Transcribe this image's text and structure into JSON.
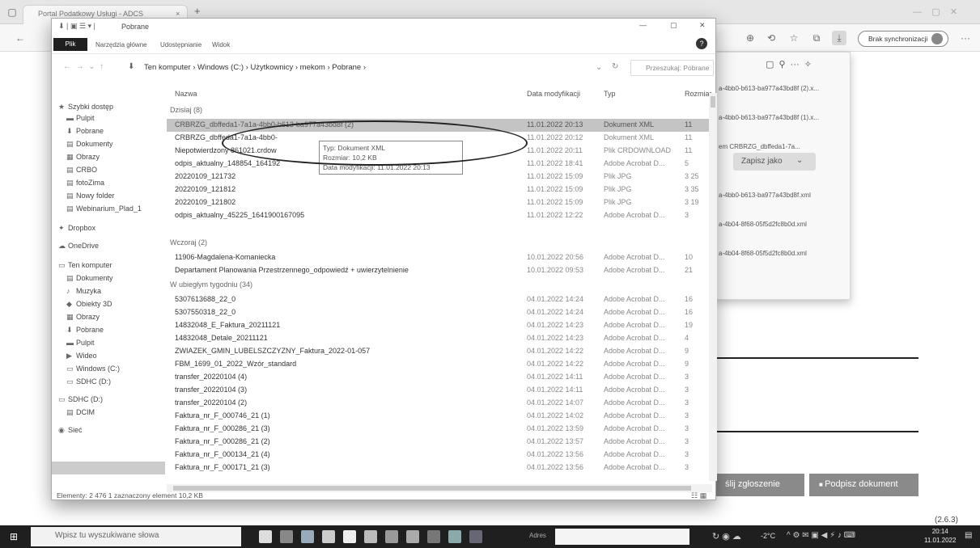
{
  "browser": {
    "tab_title": "Portal Podatkowy Usługi - ADCS",
    "tab_close": "×",
    "new_tab": "+",
    "sync": "Brak synchronizacji",
    "more": "···"
  },
  "downloads": {
    "items": [
      "a-4bb0-b613-ba977a43bd8f (2).x...",
      "a-4bb0-b613-ba977a43bd8f (1).x...",
      "em CRBRZG_dbffeda1-7a...",
      "a-4bb0-b613-ba977a43bd8f.xml",
      "a-4b04-8f68-05f5d2fc8b0d.xml",
      "a-4b04-8f68-05f5d2fc8b0d.xml"
    ],
    "save_as": "Zapisz jako"
  },
  "explorer": {
    "title": "Pobrane",
    "ribbon": {
      "file": "Plik",
      "home": "Narzędzia główne",
      "share": "Udostępnianie",
      "view": "Widok"
    },
    "address": "Ten komputer  ›  Windows (C:)  ›  Użytkownicy  ›  mekom  ›  Pobrane  ›",
    "search": "Przeszukaj: Pobrane",
    "columns": {
      "name": "Nazwa",
      "date": "Data modyfikacji",
      "type": "Typ",
      "size": "Rozmiar"
    },
    "nav": [
      "Szybki dostęp",
      "Pulpit",
      "Pobrane",
      "Dokumenty",
      "Obrazy",
      "CRBO",
      "fotoZima",
      "Nowy folder",
      "Webinarium_Plad_1",
      "Dropbox",
      "OneDrive",
      "Ten komputer",
      "Dokumenty",
      "Muzyka",
      "Obiekty 3D",
      "Obrazy",
      "Pobrane",
      "Pulpit",
      "Wideo",
      "Windows (C:)",
      "SDHC (D:)",
      "SDHC (D:)",
      "DCIM",
      "Sieć"
    ],
    "groups": {
      "today": "Dzisiaj (8)",
      "yesterday": "Wczoraj (2)",
      "last_week": "W ubiegłym tygodniu (34)"
    },
    "rows_today": [
      {
        "n": "CRBRZG_dbffeda1-7a1a-4bb0-b613-ba977a43bd8f (2)",
        "d": "11.01.2022 20:13",
        "t": "Dokument XML",
        "s": "11"
      },
      {
        "n": "CRBRZG_dbffeda1-7a1a-4bb0-",
        "d": "11.01.2022 20:12",
        "t": "Dokument XML",
        "s": "11"
      },
      {
        "n": "Niepotwierdzony 861021.crdow",
        "d": "11.01.2022 20:11",
        "t": "Plik CRDOWNLOAD",
        "s": "11"
      },
      {
        "n": "odpis_aktualny_148854_164192",
        "d": "11.01.2022 18:41",
        "t": "Adobe Acrobat D...",
        "s": "5"
      },
      {
        "n": "20220109_121732",
        "d": "11.01.2022 15:09",
        "t": "Plik JPG",
        "s": "3 25"
      },
      {
        "n": "20220109_121812",
        "d": "11.01.2022 15:09",
        "t": "Plik JPG",
        "s": "3 35"
      },
      {
        "n": "20220109_121802",
        "d": "11.01.2022 15:09",
        "t": "Plik JPG",
        "s": "3 19"
      },
      {
        "n": "odpis_aktualny_45225_1641900167095",
        "d": "11.01.2022 12:22",
        "t": "Adobe Acrobat D...",
        "s": "3"
      }
    ],
    "rows_yesterday": [
      {
        "n": "11906-Magdalena-Komaniecka",
        "d": "10.01.2022 20:56",
        "t": "Adobe Acrobat D...",
        "s": "10"
      },
      {
        "n": "Departament Planowania Przestrzennego_odpowiedź + uwierzytelnienie",
        "d": "10.01.2022 09:53",
        "t": "Adobe Acrobat D...",
        "s": "21"
      }
    ],
    "rows_week": [
      {
        "n": "5307613688_22_0",
        "d": "04.01.2022 14:24",
        "t": "Adobe Acrobat D...",
        "s": "16"
      },
      {
        "n": "5307550318_22_0",
        "d": "04.01.2022 14:24",
        "t": "Adobe Acrobat D...",
        "s": "16"
      },
      {
        "n": "14832048_E_Faktura_20211121",
        "d": "04.01.2022 14:23",
        "t": "Adobe Acrobat D...",
        "s": "19"
      },
      {
        "n": "14832048_Detale_20211121",
        "d": "04.01.2022 14:23",
        "t": "Adobe Acrobat D...",
        "s": "4"
      },
      {
        "n": "ZWIAZEK_GMIN_LUBELSZCZYZNY_Faktura_2022-01-057",
        "d": "04.01.2022 14:22",
        "t": "Adobe Acrobat D...",
        "s": "9"
      },
      {
        "n": "FBM_1699_01_2022_Wzór_standard",
        "d": "04.01.2022 14:22",
        "t": "Adobe Acrobat D...",
        "s": "9"
      },
      {
        "n": "transfer_20220104 (4)",
        "d": "04.01.2022 14:11",
        "t": "Adobe Acrobat D...",
        "s": "3"
      },
      {
        "n": "transfer_20220104 (3)",
        "d": "04.01.2022 14:11",
        "t": "Adobe Acrobat D...",
        "s": "3"
      },
      {
        "n": "transfer_20220104 (2)",
        "d": "04.01.2022 14:07",
        "t": "Adobe Acrobat D...",
        "s": "3"
      },
      {
        "n": "Faktura_nr_F_000746_21 (1)",
        "d": "04.01.2022 14:02",
        "t": "Adobe Acrobat D...",
        "s": "3"
      },
      {
        "n": "Faktura_nr_F_000286_21 (3)",
        "d": "04.01.2022 13:59",
        "t": "Adobe Acrobat D...",
        "s": "3"
      },
      {
        "n": "Faktura_nr_F_000286_21 (2)",
        "d": "04.01.2022 13:57",
        "t": "Adobe Acrobat D...",
        "s": "3"
      },
      {
        "n": "Faktura_nr_F_000134_21 (4)",
        "d": "04.01.2022 13:56",
        "t": "Adobe Acrobat D...",
        "s": "3"
      },
      {
        "n": "Faktura_nr_F_000171_21 (3)",
        "d": "04.01.2022 13:56",
        "t": "Adobe Acrobat D...",
        "s": "3"
      }
    ],
    "tooltip": [
      "Typ: Dokument XML",
      "Rozmiar: 10,2 KB",
      "Data modyfikacji: 11.01.2022 20:13"
    ],
    "status": "Elementy: 2 476     1 zaznaczony element 10,2 KB"
  },
  "page": {
    "btn_send": "ślij zgłoszenie",
    "btn_sign": "Podpisz dokument",
    "ref": "(2.6.3)"
  },
  "taskbar": {
    "search": "Wpisz tu wyszukiwane słowa",
    "address_label": "Adres",
    "temp": "-2°C",
    "time": "20:14",
    "date": "11.01.2022"
  }
}
